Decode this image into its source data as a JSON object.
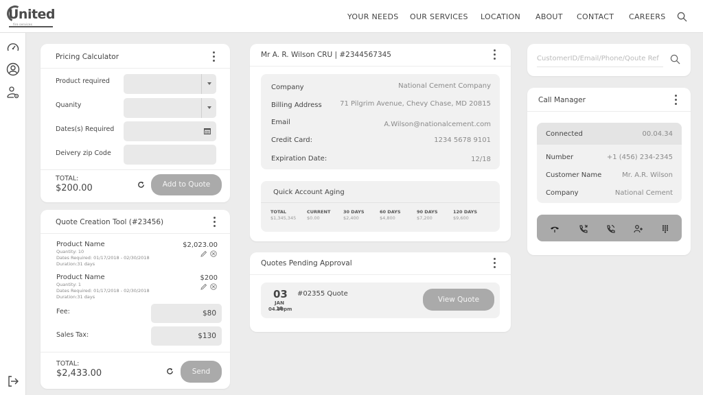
{
  "brand": {
    "name": "United",
    "sub": "fire services"
  },
  "nav": {
    "items": [
      "YOUR NEEDS",
      "OUR SERVICES",
      "LOCATION",
      "ABOUT",
      "CONTACT",
      "CAREERS"
    ]
  },
  "pricing": {
    "title": "Pricing Calculator",
    "fields": [
      "Product required",
      "Quanity",
      "Dates(s) Required",
      "Deivery zip Code"
    ],
    "total_label": "TOTAL:",
    "total_value": "$200.00",
    "button": "Add to Quote"
  },
  "quote_tool": {
    "title": "Quote Creation Tool (#23456)",
    "products": [
      {
        "name": "Product Name",
        "quantity": "Quantity: 10",
        "dates": "Dates Required: 01/17/2018 - 02/30/2018",
        "duration": "Duration:31 days",
        "price": "$2,023.00"
      },
      {
        "name": "Product Name",
        "quantity": "Quantity: 1",
        "dates": "Dates Required: 01/17/2018 - 02/30/2018",
        "duration": "Duration:31 days",
        "price": "$200"
      }
    ],
    "fee_label": "Fee:",
    "fee_value": "$80",
    "tax_label": "Sales Tax:",
    "tax_value": "$130",
    "total_label": "TOTAL:",
    "total_value": "$2,433.00",
    "button": "Send"
  },
  "customer": {
    "title": "Mr A. R. Wilson CRU | #2344567345",
    "rows": [
      {
        "label": "Company",
        "value": "National Cement Company"
      },
      {
        "label": "Billing Address",
        "value": "71 Pilgrim Avenue, Chevy Chase, MD 20815"
      },
      {
        "label": "Email",
        "value": "A.Wilson@nationalcement.com"
      },
      {
        "label": "Credit Card:",
        "value": "1234 5678 9101"
      },
      {
        "label": "Expiration Date:",
        "value": "12/18"
      }
    ],
    "aging": {
      "title": "Quick Account Aging",
      "columns": [
        {
          "head": "TOTAL",
          "value": "$1,345,345"
        },
        {
          "head": "CURRENT",
          "value": "$0.00"
        },
        {
          "head": "30 DAYS",
          "value": "$2,400"
        },
        {
          "head": "60 DAYS",
          "value": "$4,800"
        },
        {
          "head": "90 DAYS",
          "value": "$7,200"
        },
        {
          "head": "120 DAYS",
          "value": "$9,600"
        }
      ]
    }
  },
  "quotes_pending": {
    "title": "Quotes Pending Approval",
    "day": "03",
    "month": "JAN 18",
    "time": "04.30pm",
    "quote": "#02355 Quote",
    "button": "View Quote"
  },
  "search": {
    "placeholder": "CustomerID/Email/Phone/Qoute Ref"
  },
  "call_manager": {
    "title": "Call Manager",
    "status_label": "Connected",
    "status_value": "00.04.34",
    "rows": [
      {
        "label": "Number",
        "value": "+1 (456) 234-2345"
      },
      {
        "label": "Customer Name",
        "value": "Mr. A.R. Wilson"
      },
      {
        "label": "Company",
        "value": "National Cement"
      }
    ]
  },
  "colors": {
    "accent_gray": "#aaaaaa",
    "field_gray": "#e9e9e9",
    "background": "#ececec"
  }
}
